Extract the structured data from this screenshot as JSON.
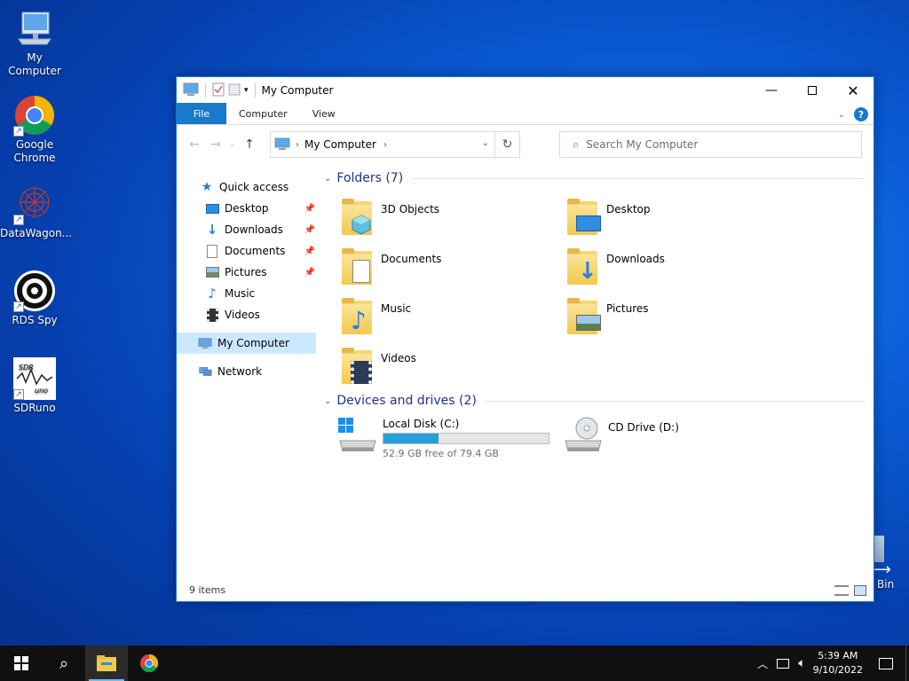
{
  "desktop": {
    "icons": [
      {
        "label": "My Computer"
      },
      {
        "label": "Google Chrome"
      },
      {
        "label": "DataWagon..."
      },
      {
        "label": "RDS Spy"
      },
      {
        "label": "SDRuno"
      }
    ],
    "recycle_partial_label": "Bin"
  },
  "window": {
    "title": "My Computer",
    "ribbon_tabs": [
      "File",
      "Computer",
      "View"
    ],
    "address": {
      "crumb": "My Computer"
    },
    "search": {
      "placeholder": "Search My Computer"
    },
    "sidebar": {
      "quick_access": "Quick access",
      "items": [
        {
          "label": "Desktop",
          "icon": "desktop-icon",
          "pinned": true
        },
        {
          "label": "Downloads",
          "icon": "download-icon",
          "pinned": true
        },
        {
          "label": "Documents",
          "icon": "document-icon",
          "pinned": true
        },
        {
          "label": "Pictures",
          "icon": "picture-icon",
          "pinned": true
        },
        {
          "label": "Music",
          "icon": "music-icon",
          "pinned": false
        },
        {
          "label": "Videos",
          "icon": "video-icon",
          "pinned": false
        }
      ],
      "my_computer": "My Computer",
      "network": "Network"
    },
    "folders_header": "Folders (7)",
    "folders": [
      {
        "label": "3D Objects",
        "icon": "3d-objects-icon"
      },
      {
        "label": "Desktop",
        "icon": "desktop-folder-icon"
      },
      {
        "label": "Documents",
        "icon": "documents-folder-icon"
      },
      {
        "label": "Downloads",
        "icon": "downloads-folder-icon"
      },
      {
        "label": "Music",
        "icon": "music-folder-icon"
      },
      {
        "label": "Pictures",
        "icon": "pictures-folder-icon"
      },
      {
        "label": "Videos",
        "icon": "videos-folder-icon"
      }
    ],
    "drives_header": "Devices and drives (2)",
    "drives": [
      {
        "label": "Local Disk (C:)",
        "free_text": "52.9 GB free of 79.4 GB",
        "used_fraction": 0.334
      },
      {
        "label": "CD Drive (D:)"
      }
    ],
    "status": "9 items"
  },
  "taskbar": {
    "time": "5:39 AM",
    "date": "9/10/2022"
  },
  "colors": {
    "accent": "#1979ca",
    "selection": "#cce8ff",
    "drive_fill": "#26a0da",
    "taskbar": "#101010"
  }
}
